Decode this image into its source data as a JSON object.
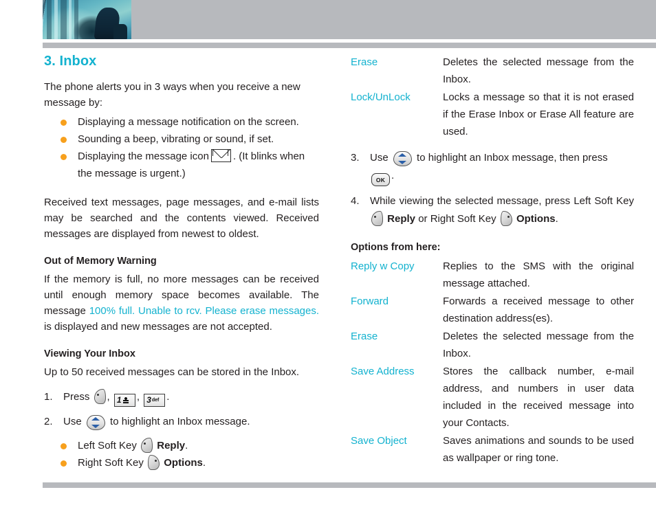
{
  "header": {
    "photo_alt": "escalator-photo",
    "band_color": "#b7b9bd"
  },
  "colors": {
    "accent_cyan": "#13b2cf",
    "bullet_orange": "#f7a01d",
    "band_gray": "#b7b9bd",
    "text": "#231f20"
  },
  "left_column": {
    "chapter_title": "3. Inbox",
    "intro": "The phone alerts you in 3 ways when you receive a new message by:",
    "alert_bullets": [
      {
        "pre": "Displaying a message notification on the screen.",
        "icon": "",
        "post": ""
      },
      {
        "pre": "Sounding a beep, vibrating or sound, if set.",
        "icon": "",
        "post": ""
      },
      {
        "pre": "Displaying the message icon",
        "icon": "envelope-icon",
        "post": ". (It blinks when the message is urgent.)"
      }
    ],
    "received_paragraph": "Received text messages, page messages, and e-mail lists may be searched and the contents viewed. Received messages are displayed from newest to oldest.",
    "memory_heading": "Out of Memory Warning",
    "memory_para_1": "If the memory is full, no more messages can be received until enough memory space becomes available. The message",
    "memory_quote": "100% full. Unable to rcv. Please erase messages.",
    "memory_para_2": "is displayed and new messages are not accepted.",
    "viewing_heading": "Viewing Your Inbox",
    "viewing_para": "Up to 50 received messages can be stored in the Inbox.",
    "step_1_num": "1.",
    "step_1_pre": "Press",
    "step_1_key_1_digit": "1",
    "step_1_key_2_digit": "3",
    "step_1_key_2_letters": "def",
    "step_1_sep": ",",
    "step_1_end": ".",
    "step_2_num": "2.",
    "step_2_pre": "Use",
    "step_2_post": "to highlight an Inbox message.",
    "softkey_bullets": [
      {
        "label": "Left Soft Key",
        "key": "left-soft-key",
        "action": "Reply",
        "end": "."
      },
      {
        "label": "Right Soft Key",
        "key": "right-soft-key",
        "action": "Options",
        "end": "."
      }
    ]
  },
  "right_column": {
    "top_options": [
      {
        "term": "Erase",
        "desc": "Deletes the selected message from the Inbox."
      },
      {
        "term": "Lock/UnLock",
        "desc": "Locks a message so that it is not erased if the Erase Inbox or Erase All feature are used."
      }
    ],
    "step_3_num": "3.",
    "step_3_pre": "Use",
    "step_3_mid": "to highlight an Inbox message, then press",
    "step_3_ok_label": "OK",
    "step_3_end": ".",
    "step_4_num": "4.",
    "step_4_part_1": "While viewing the selected message, press Left Soft Key",
    "step_4_action_1": "Reply",
    "step_4_mid": "or Right Soft Key",
    "step_4_action_2": "Options",
    "step_4_end": ".",
    "options_heading": "Options from here:",
    "options": [
      {
        "term": "Reply w Copy",
        "desc": "Replies to the SMS with the original message attached."
      },
      {
        "term": "Forward",
        "desc": "Forwards a received message to other destination address(es)."
      },
      {
        "term": "Erase",
        "desc": "Deletes the selected message from the Inbox."
      },
      {
        "term": "Save Address",
        "desc": "Stores the callback number, e-mail address, and numbers in user data included in the received message into your Contacts."
      },
      {
        "term": "Save Object",
        "desc": "Saves animations and sounds to be used as wallpaper or ring tone."
      }
    ]
  }
}
